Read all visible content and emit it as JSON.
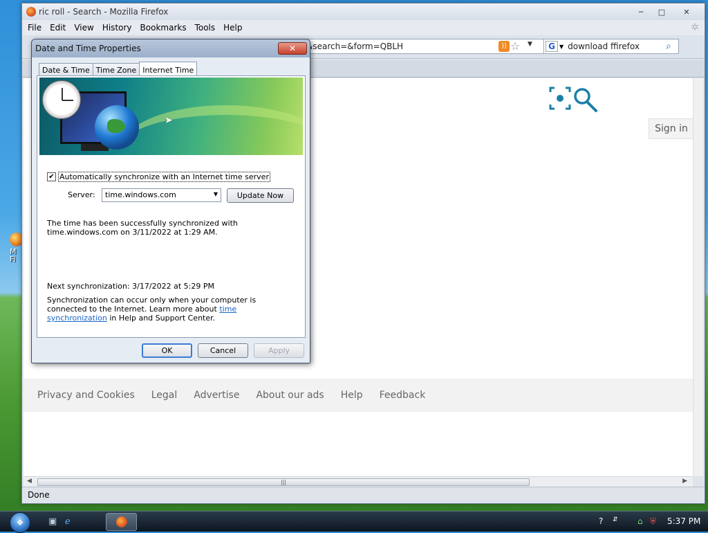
{
  "desktop": {
    "icon_label": "M\nFi"
  },
  "browser": {
    "title": "ric roll - Search - Mozilla Firefox",
    "window_buttons": [
      "─",
      "□",
      "✕"
    ],
    "menu": [
      "File",
      "Edit",
      "View",
      "History",
      "Bookmarks",
      "Tools",
      "Help"
    ],
    "url": "-roll&search=&form=QBLH",
    "search_value": "download ffirefox",
    "search_engine_letter": "G",
    "status": "Done"
  },
  "page": {
    "sign_in": "Sign in",
    "footer_links": [
      "Privacy and Cookies",
      "Legal",
      "Advertise",
      "About our ads",
      "Help",
      "Feedback"
    ],
    "logo_color": "#1a7fa6"
  },
  "dialog": {
    "title": "Date and Time Properties",
    "close_glyph": "✕",
    "tabs": [
      "Date & Time",
      "Time Zone",
      "Internet Time"
    ],
    "active_tab": "Internet Time",
    "auto_sync_label": "Automatically synchronize with an Internet time server",
    "auto_sync_checked": true,
    "server_label": "Server:",
    "server_value": "time.windows.com",
    "update_now": "Update Now",
    "sync_message": "The time has been successfully synchronized with time.windows.com on 3/11/2022 at 1:29 AM.",
    "next_sync": "Next synchronization: 3/17/2022 at 5:29 PM",
    "note_prefix": "Synchronization can occur only when your computer is connected to the Internet.  Learn more about ",
    "note_link": "time synchronization",
    "note_suffix": " in Help and Support Center.",
    "ok": "OK",
    "cancel": "Cancel",
    "apply": "Apply"
  },
  "taskbar": {
    "time": "5:37 PM"
  }
}
